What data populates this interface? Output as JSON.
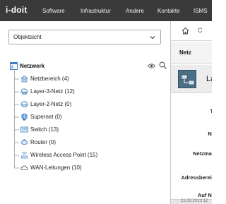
{
  "header": {
    "logo": "i-doit",
    "nav": [
      {
        "label": "Software"
      },
      {
        "label": "Infrastruktur"
      },
      {
        "label": "Andere"
      },
      {
        "label": "Kontakte"
      },
      {
        "label": "ISMS"
      }
    ]
  },
  "left": {
    "view_select": {
      "value": "Objektsicht"
    },
    "tree": {
      "root": {
        "label": "Netzwerk",
        "icon": "network-folder-icon"
      },
      "items": [
        {
          "label": "Netzbereich (4)",
          "icon": "network-range-icon"
        },
        {
          "label": "Layer-3-Netz (12)",
          "icon": "layer3-net-icon"
        },
        {
          "label": "Layer-2-Netz (0)",
          "icon": "layer2-net-icon"
        },
        {
          "label": "Supernet (0)",
          "icon": "supernet-icon"
        },
        {
          "label": "Switch (13)",
          "icon": "switch-icon"
        },
        {
          "label": "Router (0)",
          "icon": "router-icon"
        },
        {
          "label": "Wireless Access Point (15)",
          "icon": "wireless-access-point-icon"
        },
        {
          "label": "WAN-Leitungen (10)",
          "icon": "cloud-icon"
        }
      ]
    }
  },
  "right": {
    "breadcrumb_sep": "C",
    "section_title": "Netz",
    "object_title": "La",
    "fields": [
      {
        "label": "Ti"
      },
      {
        "label": "Ne"
      },
      {
        "label": "Netzmas"
      },
      {
        "label": "Adressbereic"
      },
      {
        "label": "Auf Ne"
      }
    ],
    "footer": "21.03.2023 12"
  },
  "colors": {
    "topbar": "#3a3a3a",
    "tree_icon_blue": "#3f7fc0",
    "section_bg": "#f3f3f3"
  }
}
